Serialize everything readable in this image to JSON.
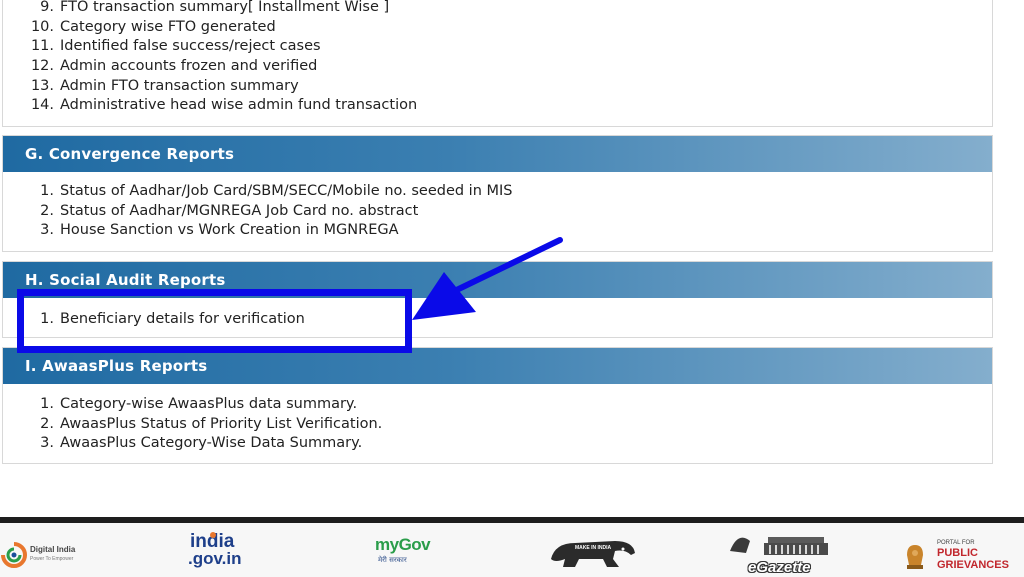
{
  "sections": {
    "f": {
      "items": [
        {
          "num": "9.",
          "label": "FTO transaction summary[ Installment Wise ]"
        },
        {
          "num": "10.",
          "label": "Category wise FTO generated"
        },
        {
          "num": "11.",
          "label": "Identified false success/reject cases"
        },
        {
          "num": "12.",
          "label": "Admin accounts frozen and verified"
        },
        {
          "num": "13.",
          "label": "Admin FTO transaction summary"
        },
        {
          "num": "14.",
          "label": "Administrative head wise admin fund transaction"
        }
      ]
    },
    "g": {
      "title": "G. Convergence Reports",
      "items": [
        {
          "num": "1.",
          "label": "Status of Aadhar/Job Card/SBM/SECC/Mobile no. seeded in MIS"
        },
        {
          "num": "2.",
          "label": "Status of Aadhar/MGNREGA Job Card no. abstract"
        },
        {
          "num": "3.",
          "label": "House Sanction vs Work Creation in MGNREGA"
        }
      ]
    },
    "h": {
      "title": "H. Social Audit Reports",
      "items": [
        {
          "num": "1.",
          "label": "Beneficiary details for verification"
        }
      ]
    },
    "i": {
      "title": "I. AwaasPlus Reports",
      "items": [
        {
          "num": "1.",
          "label": "Category-wise AwaasPlus data summary."
        },
        {
          "num": "2.",
          "label": "AwaasPlus Status of Priority List Verification."
        },
        {
          "num": "3.",
          "label": "AwaasPlus Category-Wise Data Summary."
        }
      ]
    }
  },
  "annotation": {
    "color": "#0a0ae8"
  },
  "footer": {
    "logos": {
      "digital_india": {
        "main": "Digital India",
        "sub": "Power To Empower",
        "icon": "digital-india-swirl"
      },
      "india_gov": {
        "line1": "india",
        "line2": ".gov.in"
      },
      "mygov": {
        "main": "myGov",
        "sub": "मेरी सरकार"
      },
      "make_in_india": {
        "text": "MAKE IN INDIA",
        "icon": "lion-icon"
      },
      "egazette": {
        "text": "eGazette",
        "icon": "parliament-icon"
      },
      "pg_portal": {
        "line1": "PORTAL FOR",
        "line2": "PUBLIC",
        "line3": "GRIEVANCES",
        "icon": "national-emblem-icon"
      }
    }
  }
}
